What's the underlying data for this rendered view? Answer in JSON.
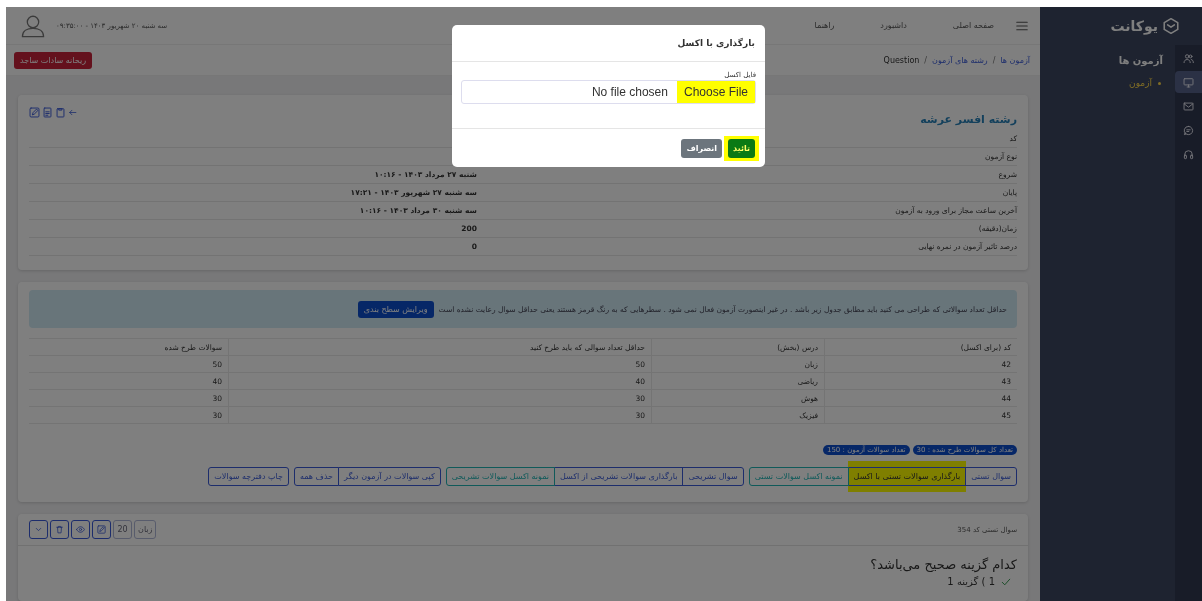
{
  "sidebar": {
    "brand": "یوکانت",
    "menu": [
      {
        "label": "آزمون ها",
        "children": [
          {
            "label": "آزمون",
            "selected": true
          }
        ]
      }
    ],
    "icon_strip": [
      {
        "selected": false
      },
      {
        "selected": true
      },
      {
        "selected": false
      },
      {
        "selected": false
      },
      {
        "selected": false
      }
    ]
  },
  "topbar": {
    "nav_links": [
      "صفحه اصلی",
      "داشبورد",
      "راهنما"
    ],
    "datetime": "سه شنبه ۲۰ شهریور ۱۴۰۳ - ۰۹:۳۵:۰۰"
  },
  "breadcrumb": [
    {
      "kind": "link",
      "label": "آزمون ها"
    },
    {
      "kind": "separator",
      "label": "/"
    },
    {
      "kind": "link",
      "label": "رشته های آزمون"
    },
    {
      "kind": "separator",
      "label": "/"
    },
    {
      "kind": "current",
      "label": "Question"
    }
  ],
  "user_button": "ریحانه سادات ساجد",
  "exam_card": {
    "title": "رشته افسر عرشه",
    "rows": [
      {
        "label": "کد",
        "value": ""
      },
      {
        "label": "نوع آزمون",
        "value": ""
      },
      {
        "label": "شروع",
        "value": "شنبه ۲۷ مرداد ۱۴۰۳ - ۱۰:۱۶"
      },
      {
        "label": "پایان",
        "value": "سه شنبه ۲۷ شهریور ۱۴۰۳ - ۱۷:۲۱"
      },
      {
        "label": "آخرین ساعت مجاز برای ورود به آزمون",
        "value": "سه شنبه ۳۰ مرداد ۱۴۰۳ - ۱۰:۱۶"
      },
      {
        "label": "زمان(دقیقه)",
        "value": "200"
      },
      {
        "label": "درصد تاثیر آزمون در نمره نهایی",
        "value": "0"
      }
    ]
  },
  "alert": {
    "text": "حداقل تعداد سوالاتی که طراحی می کنید باید مطابق جدول زیر باشد . در غیر اینصورت آزمون فعال نمی شود . سطرهایی که به رنگ قرمز هستند یعنی حداقل سوال رعایت نشده است",
    "button": "ویرایش سطح بندی"
  },
  "table": {
    "columns": [
      "کد (برای اکسل)",
      "درس (بخش)",
      "حداقل تعداد سوالی که باید طرح کنید",
      "سوالات طرح شده"
    ],
    "rows": [
      [
        "42",
        "زبان",
        "50",
        "50"
      ],
      [
        "43",
        "ریاضی",
        "40",
        "40"
      ],
      [
        "44",
        "هوش",
        "30",
        "30"
      ],
      [
        "45",
        "فیزیک",
        "30",
        "30"
      ]
    ]
  },
  "badges": [
    "تعداد کل سوالات طرح شده : 30",
    "تعداد سوالات آزمون : 150"
  ],
  "action_groups": [
    {
      "buttons": [
        {
          "label": "سوال تستی",
          "kind": "primary",
          "highlighted": false
        },
        {
          "label": "بارگذاری سوالات تستی با اکسل",
          "kind": "primary",
          "highlighted": true
        },
        {
          "label": "نمونه اکسل سوالات تستی",
          "kind": "info",
          "highlighted": false
        }
      ]
    },
    {
      "buttons": [
        {
          "label": "سوال تشریحی",
          "kind": "primary",
          "highlighted": false
        },
        {
          "label": "بارگذاری سوالات تشریحی از اکسل",
          "kind": "primary",
          "highlighted": false
        },
        {
          "label": "نمونه اکسل سوالات تشریحی",
          "kind": "info",
          "highlighted": false
        }
      ]
    },
    {
      "buttons": [
        {
          "label": "کپی سوالات در آزمون دیگر",
          "kind": "primary",
          "highlighted": false
        },
        {
          "label": "حذف همه",
          "kind": "primary",
          "highlighted": false
        }
      ]
    },
    {
      "buttons": [
        {
          "label": "چاپ دفترچه سوالات",
          "kind": "primary",
          "highlighted": false
        }
      ]
    }
  ],
  "question_card": {
    "header": "سوال تستی کد 354",
    "tags": [
      "زبان",
      "20"
    ],
    "question": "کدام گزینه صحیح می‌باشد؟",
    "options": [
      {
        "label": "1 ) گزینه 1",
        "correct": true
      }
    ]
  },
  "modal": {
    "title": "بارگذاری با اکسل",
    "field_label": "فایل اکسل",
    "file_button": "Choose File",
    "file_status": "No file chosen",
    "file_button_highlighted": true,
    "buttons": [
      {
        "label": "تائید",
        "kind": "confirm",
        "highlighted": true
      },
      {
        "label": "انصراف",
        "kind": "cancel",
        "highlighted": false
      }
    ]
  }
}
